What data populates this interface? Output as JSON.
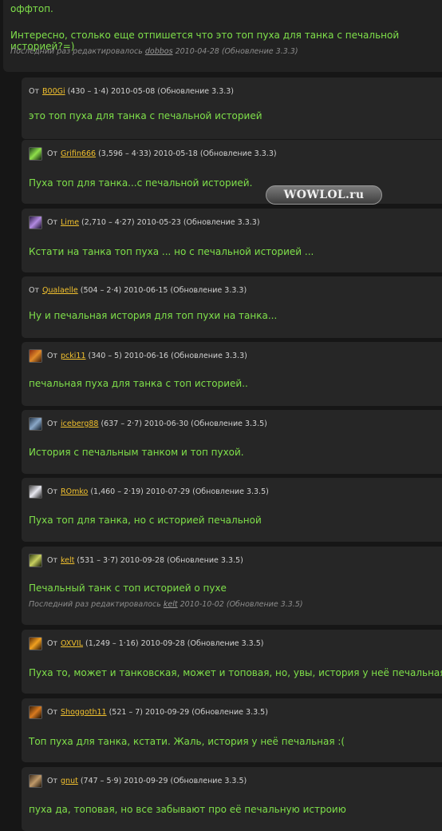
{
  "top_post": {
    "line1": "оффтоп.",
    "line2": "Интересно, столько еще отпишется что это топ пуха для танка с печальной историей?=)",
    "edit_note_prefix": "Последний раз редактировалось",
    "edit_note_user": "dobbos",
    "edit_note_suffix": "2010-04-28 (Обновление 3.3.3)"
  },
  "from_label": "От",
  "watermark": "WOWLOL.ru",
  "replies": [
    {
      "user": "B00Gi",
      "counts": "(430 – 1·4)",
      "date": "2010-05-08 (Обновление 3.3.3)",
      "text": "это топ пуха для танка с печальной историей",
      "avatar": "none"
    },
    {
      "user": "Grifin666",
      "counts": "(3,596 – 4·33)",
      "date": "2010-05-18 (Обновление 3.3.3)",
      "text": "Пуха топ для танка...с печальной историей.",
      "avatar": "green-portrait"
    },
    {
      "user": "Lime",
      "counts": "(2,710 – 4·27)",
      "date": "2010-05-23 (Обновление 3.3.3)",
      "text": "Кстати на танка топ пуха ... но с печальной историей ...",
      "avatar": "purple-portrait"
    },
    {
      "user": "Qualaelle",
      "counts": "(504 – 2·4)",
      "date": "2010-06-15 (Обновление 3.3.3)",
      "text": "Ну и печальная история для топ пухи на танка...",
      "avatar": "none"
    },
    {
      "user": "pcki11",
      "counts": "(340 – 5)",
      "date": "2010-06-16 (Обновление 3.3.3)",
      "text": "печальная пуха для танка с топ историей..",
      "avatar": "red-portrait"
    },
    {
      "user": "iceberg88",
      "counts": "(637 – 2·7)",
      "date": "2010-06-30 (Обновление 3.3.5)",
      "text": "История с печальным танком и топ пухой.",
      "avatar": "steel-portrait"
    },
    {
      "user": "ROmko",
      "counts": "(1,460 – 2·19)",
      "date": "2010-07-29 (Обновление 3.3.5)",
      "text": "Пуха топ для танка, но с историей печальной",
      "avatar": "white-portrait"
    },
    {
      "user": "kelt",
      "counts": "(531 – 3·7)",
      "date": "2010-09-28 (Обновление 3.3.5)",
      "text": "Печальный танк с топ историей о пухе",
      "avatar": "olive-portrait",
      "edit_note_prefix": "Последний раз редактировалось",
      "edit_note_user": "kelt",
      "edit_note_suffix": "2010-10-02 (Обновление 3.3.5)"
    },
    {
      "user": "OXVIL",
      "counts": "(1,249 – 1·16)",
      "date": "2010-09-28 (Обновление 3.3.5)",
      "text": "Пуха то, может и танковская, может и топовая, но, увы, история у неё печальная...",
      "avatar": "orange-portrait"
    },
    {
      "user": "Shoggoth11",
      "counts": "(521 – 7)",
      "date": "2010-09-29 (Обновление 3.3.5)",
      "text": "Топ пуха для танка, кстати. Жаль, история у неё печальная :(",
      "avatar": "amber-portrait"
    },
    {
      "user": "gnut",
      "counts": "(747 – 5·9)",
      "date": "2010-09-29 (Обновление 3.3.5)",
      "text": "пуха да, топовая, но все забывают про её печальную истроию",
      "avatar": "bronze-portrait"
    }
  ]
}
